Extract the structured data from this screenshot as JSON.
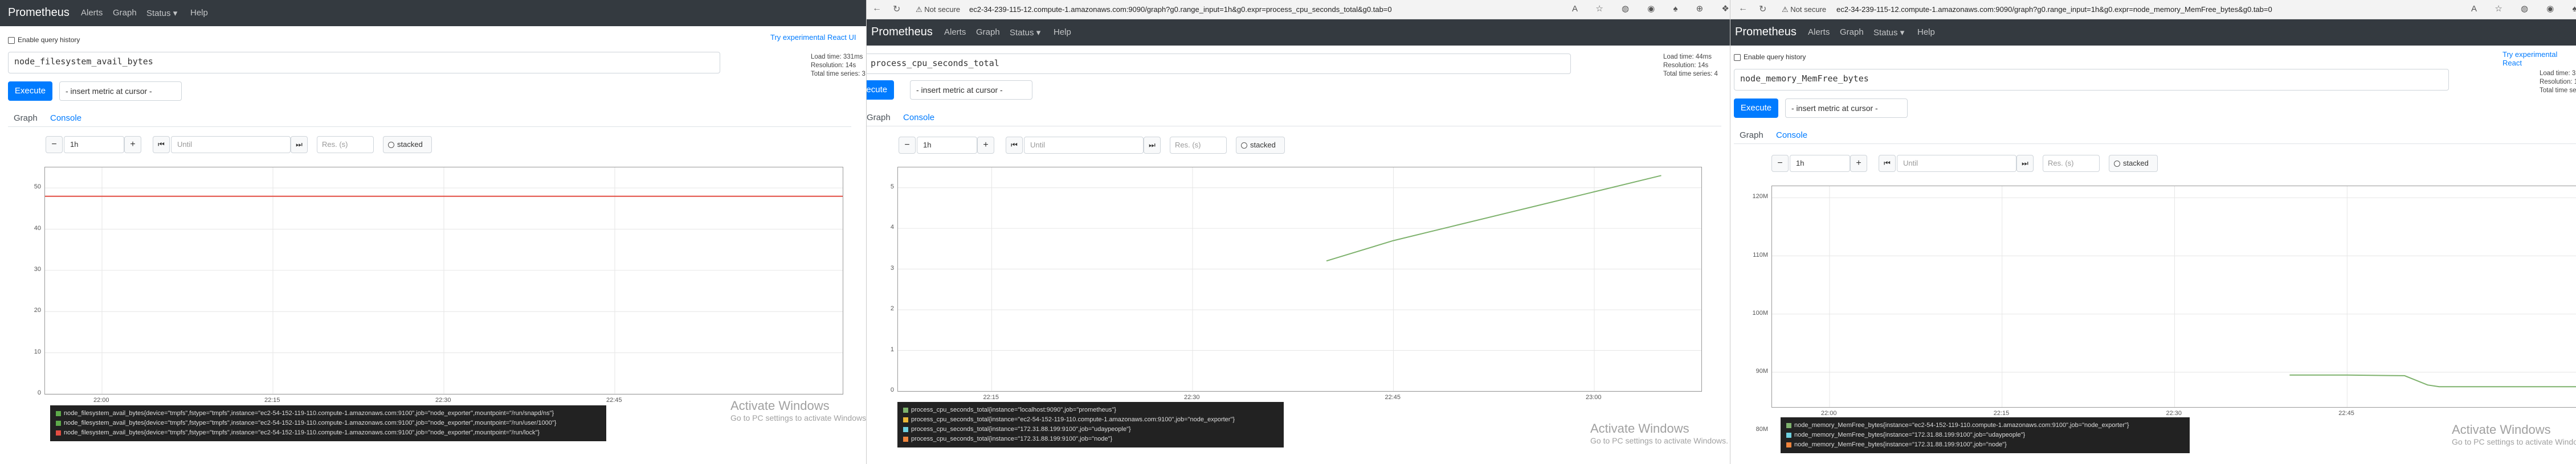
{
  "panels": [
    {
      "navbar": {
        "brand": "Prometheus",
        "links": [
          "Alerts",
          "Graph",
          "Status ▾",
          "Help"
        ]
      },
      "enable_history": "Enable query history",
      "try_react": "Try experimental React UI",
      "expression": "node_filesystem_avail_bytes",
      "stats": [
        "Load time: 331ms",
        "Resolution: 14s",
        "Total time series: 3"
      ],
      "execute": "Execute",
      "insert_metric": "- insert metric at cursor -",
      "tabs": [
        "Graph",
        "Console"
      ],
      "range": "1h",
      "until_placeholder": "Until",
      "res_placeholder": "Res. (s)",
      "stacked": "stacked",
      "y_ticks": [
        "50",
        "40",
        "30",
        "20",
        "10",
        "0"
      ],
      "x_ticks": [
        "22:00",
        "22:15",
        "22:30",
        "22:45"
      ],
      "legend": [
        {
          "text": "node_filesystem_avail_bytes{device=\"tmpfs\",fstype=\"tmpfs\",instance=\"ec2-54-152-119-110.compute-1.amazonaws.com:9100\",job=\"node_exporter\",mountpoint=\"/run/snapd/ns\"}",
          "color": "#5eab4a"
        },
        {
          "text": "node_filesystem_avail_bytes{device=\"tmpfs\",fstype=\"tmpfs\",instance=\"ec2-54-152-119-110.compute-1.amazonaws.com:9100\",job=\"node_exporter\",mountpoint=\"/run/user/1000\"}",
          "color": "#5eab4a"
        },
        {
          "text": "node_filesystem_avail_bytes{device=\"tmpfs\",fstype=\"tmpfs\",instance=\"ec2-54-152-119-110.compute-1.amazonaws.com:9100\",job=\"node_exporter\",mountpoint=\"/run/lock\"}",
          "color": "#e24d42"
        }
      ],
      "watermark": {
        "title": "Activate Windows",
        "sub": "Go to PC settings to activate Windows."
      }
    },
    {
      "browser": {
        "not_secure": "Not secure",
        "url": "ec2-34-239-115-12.compute-1.amazonaws.com:9090/graph?g0.range_input=1h&g0.expr=process_cpu_seconds_total&g0.tab=0"
      },
      "navbar": {
        "brand": "Prometheus",
        "links": [
          "Alerts",
          "Graph",
          "Status ▾",
          "Help"
        ]
      },
      "expression": "process_cpu_seconds_total",
      "stats": [
        "Load time: 44ms",
        "Resolution: 14s",
        "Total time series: 4"
      ],
      "execute": "Execute",
      "insert_metric": "- insert metric at cursor -",
      "tabs": [
        "Graph",
        "Console"
      ],
      "range": "1h",
      "until_placeholder": "Until",
      "res_placeholder": "Res. (s)",
      "stacked": "stacked",
      "y_ticks": [
        "5",
        "4",
        "3",
        "2",
        "1",
        "0"
      ],
      "x_ticks": [
        "22:15",
        "22:30",
        "22:45",
        "23:00"
      ],
      "legend": [
        {
          "text": "process_cpu_seconds_total{instance=\"localhost:9090\",job=\"prometheus\"}",
          "color": "#7eb26d"
        },
        {
          "text": "process_cpu_seconds_total{instance=\"ec2-54-152-119-110.compute-1.amazonaws.com:9100\",job=\"node_exporter\"}",
          "color": "#eab839"
        },
        {
          "text": "process_cpu_seconds_total{instance=\"172.31.88.199:9100\",job=\"udaypeople\"}",
          "color": "#6ed0e0"
        },
        {
          "text": "process_cpu_seconds_total{instance=\"172.31.88.199:9100\",job=\"node\"}",
          "color": "#ef843c"
        }
      ],
      "watermark": {
        "title": "Activate Windows",
        "sub": "Go to PC settings to activate Windows."
      }
    },
    {
      "browser": {
        "not_secure": "Not secure",
        "url": "ec2-34-239-115-12.compute-1.amazonaws.com:9090/graph?g0.range_input=1h&g0.expr=node_memory_MemFree_bytes&g0.tab=0"
      },
      "navbar": {
        "brand": "Prometheus",
        "links": [
          "Alerts",
          "Graph",
          "Status ▾",
          "Help"
        ]
      },
      "enable_history": "Enable query history",
      "try_react": "Try experimental React",
      "expression": "node_memory_MemFree_bytes",
      "stats": [
        "Load time: 32",
        "Resolution: 1",
        "Total time se"
      ],
      "execute": "Execute",
      "insert_metric": "- insert metric at cursor -",
      "tabs": [
        "Graph",
        "Console"
      ],
      "range": "1h",
      "until_placeholder": "Until",
      "res_placeholder": "Res. (s)",
      "stacked": "stacked",
      "y_ticks": [
        "120M",
        "110M",
        "100M",
        "90M",
        "80M"
      ],
      "x_ticks": [
        "22:00",
        "22:15",
        "22:30",
        "22:45"
      ],
      "legend": [
        {
          "text": "node_memory_MemFree_bytes{instance=\"ec2-54-152-119-110.compute-1.amazonaws.com:9100\",job=\"node_exporter\"}",
          "color": "#7eb26d"
        },
        {
          "text": "node_memory_MemFree_bytes{instance=\"172.31.88.199:9100\",job=\"udaypeople\"}",
          "color": "#6ed0e0"
        },
        {
          "text": "node_memory_MemFree_bytes{instance=\"172.31.88.199:9100\",job=\"node\"}",
          "color": "#ef843c"
        }
      ],
      "watermark": {
        "title": "Activate Windows",
        "sub": "Go to PC settings to activate Windows."
      }
    }
  ],
  "chart_data": [
    {
      "type": "line",
      "x": [
        "21:55",
        "23:05"
      ],
      "series": [
        {
          "values": [
            48,
            48
          ]
        }
      ],
      "ylim": [
        0,
        55
      ],
      "grid": true
    },
    {
      "type": "line",
      "x": [
        "22:40",
        "22:45",
        "22:50",
        "22:55",
        "23:00",
        "23:05"
      ],
      "series": [
        {
          "values": [
            3.2,
            3.7,
            4.1,
            4.5,
            4.9,
            5.3
          ]
        }
      ],
      "ylim": [
        0,
        5.5
      ],
      "grid": true
    },
    {
      "type": "line",
      "x": [
        "22:40",
        "22:45",
        "22:50",
        "22:52",
        "22:53",
        "23:05"
      ],
      "series": [
        {
          "values": [
            89.5,
            89.5,
            89.4,
            87.8,
            87.5,
            87.5
          ]
        }
      ],
      "ylim": [
        84,
        122
      ],
      "grid": true
    }
  ]
}
